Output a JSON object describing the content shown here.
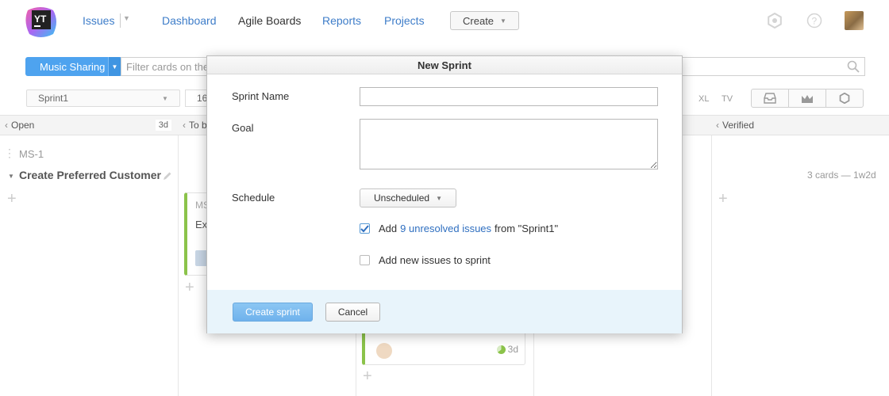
{
  "header": {
    "logo_text": "YT",
    "nav": {
      "issues": "Issues",
      "dashboard": "Dashboard",
      "agile_boards": "Agile Boards",
      "reports": "Reports",
      "projects": "Projects"
    },
    "create_label": "Create",
    "icons": [
      "settings-icon",
      "help-icon"
    ]
  },
  "board": {
    "name": "Music Sharing",
    "filter_placeholder": "Filter cards on the board",
    "sprint": "Sprint1",
    "count": "16",
    "size_labels": [
      "XL",
      "TV"
    ],
    "tools": [
      "inbox-icon",
      "burndown-icon",
      "settings-icon"
    ]
  },
  "columns": [
    {
      "title": "Open",
      "wip": "3d"
    },
    {
      "title": "To be discussed",
      "wip": ""
    },
    {
      "title": "Verified",
      "wip": ""
    }
  ],
  "swimlane": {
    "id": "MS-1",
    "title": "Create Preferred Customer",
    "meta": "3 cards  —  1w2d"
  },
  "cards": [
    {
      "id": "MS-",
      "title": "Ex",
      "estimate": ""
    },
    {
      "id": "",
      "title": "",
      "estimate": "3d"
    }
  ],
  "dialog": {
    "title": "New Sprint",
    "sprint_name_label": "Sprint Name",
    "sprint_name_value": "",
    "goal_label": "Goal",
    "goal_value": "",
    "schedule_label": "Schedule",
    "schedule_value": "Unscheduled",
    "option_add_unresolved": {
      "checked": true,
      "prefix": "Add",
      "link": "9 unresolved issues",
      "suffix": "from \"Sprint1\""
    },
    "option_add_new": {
      "checked": false,
      "label": "Add new issues to sprint"
    },
    "create_button": "Create sprint",
    "cancel_button": "Cancel"
  },
  "colors": {
    "accent_blue": "#4ea3ef",
    "link_blue": "#2f6fc0",
    "card_green": "#8bc34a",
    "footer_bg": "#e8f4fb"
  }
}
